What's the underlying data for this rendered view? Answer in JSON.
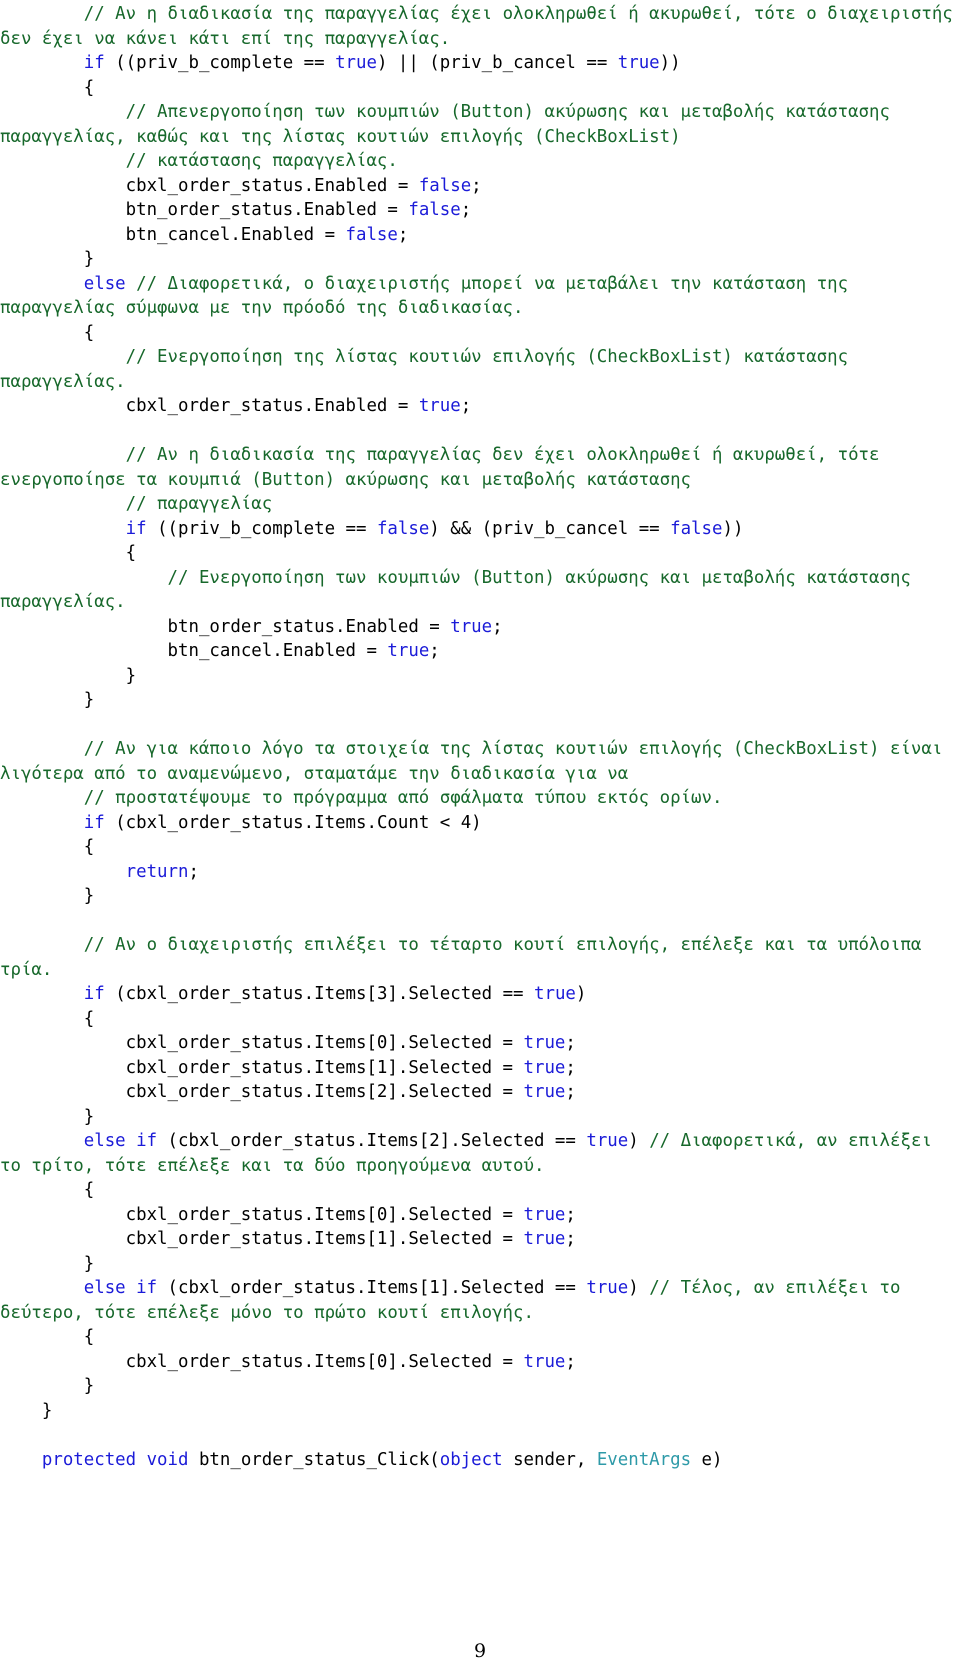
{
  "page": {
    "number": "9",
    "language": "csharp",
    "colors": {
      "comment": "#17682b",
      "keyword": "#1b1bd8",
      "type": "#2e9aa8",
      "plain": "#000000",
      "background": "#ffffff"
    }
  },
  "code": {
    "lines": [
      {
        "indent": 2,
        "spans": [
          {
            "t": "cm",
            "s": "// Αν η διαδικασία της παραγγελίας έχει ολοκληρωθεί ή ακυρωθεί, τότε ο διαχειριστής δεν έχει να κάνει κάτι επί της παραγγελίας."
          }
        ]
      },
      {
        "indent": 2,
        "spans": [
          {
            "t": "kw",
            "s": "if"
          },
          {
            "t": "pl",
            "s": " ((priv_b_complete == "
          },
          {
            "t": "kw",
            "s": "true"
          },
          {
            "t": "pl",
            "s": ") || (priv_b_cancel == "
          },
          {
            "t": "kw",
            "s": "true"
          },
          {
            "t": "pl",
            "s": "))"
          }
        ]
      },
      {
        "indent": 2,
        "spans": [
          {
            "t": "pl",
            "s": "{"
          }
        ]
      },
      {
        "indent": 3,
        "spans": [
          {
            "t": "cm",
            "s": "// Απενεργοποίηση των κουμπιών (Button) ακύρωσης και μεταβολής κατάστασης παραγγελίας, καθώς και της λίστας κουτιών επιλογής (CheckBoxList)"
          }
        ]
      },
      {
        "indent": 3,
        "spans": [
          {
            "t": "cm",
            "s": "// κατάστασης παραγγελίας."
          }
        ]
      },
      {
        "indent": 3,
        "spans": [
          {
            "t": "pl",
            "s": "cbxl_order_status.Enabled = "
          },
          {
            "t": "kw",
            "s": "false"
          },
          {
            "t": "pl",
            "s": ";"
          }
        ]
      },
      {
        "indent": 3,
        "spans": [
          {
            "t": "pl",
            "s": "btn_order_status.Enabled = "
          },
          {
            "t": "kw",
            "s": "false"
          },
          {
            "t": "pl",
            "s": ";"
          }
        ]
      },
      {
        "indent": 3,
        "spans": [
          {
            "t": "pl",
            "s": "btn_cancel.Enabled = "
          },
          {
            "t": "kw",
            "s": "false"
          },
          {
            "t": "pl",
            "s": ";"
          }
        ]
      },
      {
        "indent": 2,
        "spans": [
          {
            "t": "pl",
            "s": "}"
          }
        ]
      },
      {
        "indent": 2,
        "spans": [
          {
            "t": "kw",
            "s": "else"
          },
          {
            "t": "pl",
            "s": " "
          },
          {
            "t": "cm",
            "s": "// Διαφορετικά, ο διαχειριστής μπορεί να μεταβάλει την κατάσταση της παραγγελίας σύμφωνα με την πρόοδό της διαδικασίας."
          }
        ]
      },
      {
        "indent": 2,
        "spans": [
          {
            "t": "pl",
            "s": "{"
          }
        ]
      },
      {
        "indent": 3,
        "spans": [
          {
            "t": "cm",
            "s": "// Ενεργοποίηση της λίστας κουτιών επιλογής (CheckBoxList) κατάστασης παραγγελίας."
          }
        ]
      },
      {
        "indent": 3,
        "spans": [
          {
            "t": "pl",
            "s": "cbxl_order_status.Enabled = "
          },
          {
            "t": "kw",
            "s": "true"
          },
          {
            "t": "pl",
            "s": ";"
          }
        ]
      },
      {
        "blank": true
      },
      {
        "indent": 3,
        "spans": [
          {
            "t": "cm",
            "s": "// Αν η διαδικασία της παραγγελίας δεν έχει ολοκληρωθεί ή ακυρωθεί, τότε ενεργοποίησε τα κουμπιά (Button) ακύρωσης και μεταβολής κατάστασης"
          }
        ]
      },
      {
        "indent": 3,
        "spans": [
          {
            "t": "cm",
            "s": "// παραγγελίας"
          }
        ]
      },
      {
        "indent": 3,
        "spans": [
          {
            "t": "kw",
            "s": "if"
          },
          {
            "t": "pl",
            "s": " ((priv_b_complete == "
          },
          {
            "t": "kw",
            "s": "false"
          },
          {
            "t": "pl",
            "s": ") && (priv_b_cancel == "
          },
          {
            "t": "kw",
            "s": "false"
          },
          {
            "t": "pl",
            "s": "))"
          }
        ]
      },
      {
        "indent": 3,
        "spans": [
          {
            "t": "pl",
            "s": "{"
          }
        ]
      },
      {
        "indent": 4,
        "spans": [
          {
            "t": "cm",
            "s": "// Ενεργοποίηση των κουμπιών (Button) ακύρωσης και μεταβολής κατάστασης παραγγελίας."
          }
        ]
      },
      {
        "indent": 4,
        "spans": [
          {
            "t": "pl",
            "s": "btn_order_status.Enabled = "
          },
          {
            "t": "kw",
            "s": "true"
          },
          {
            "t": "pl",
            "s": ";"
          }
        ]
      },
      {
        "indent": 4,
        "spans": [
          {
            "t": "pl",
            "s": "btn_cancel.Enabled = "
          },
          {
            "t": "kw",
            "s": "true"
          },
          {
            "t": "pl",
            "s": ";"
          }
        ]
      },
      {
        "indent": 3,
        "spans": [
          {
            "t": "pl",
            "s": "}"
          }
        ]
      },
      {
        "indent": 2,
        "spans": [
          {
            "t": "pl",
            "s": "}"
          }
        ]
      },
      {
        "blank": true
      },
      {
        "indent": 2,
        "spans": [
          {
            "t": "cm",
            "s": "// Αν για κάποιο λόγο τα στοιχεία της λίστας κουτιών επιλογής (CheckBoxList) είναι λιγότερα από το αναμενώμενο, σταματάμε την διαδικασία για να"
          }
        ]
      },
      {
        "indent": 2,
        "spans": [
          {
            "t": "cm",
            "s": "// προστατέψουμε το πρόγραμμα από σφάλματα τύπου εκτός ορίων."
          }
        ]
      },
      {
        "indent": 2,
        "spans": [
          {
            "t": "kw",
            "s": "if"
          },
          {
            "t": "pl",
            "s": " (cbxl_order_status.Items.Count < 4)"
          }
        ]
      },
      {
        "indent": 2,
        "spans": [
          {
            "t": "pl",
            "s": "{"
          }
        ]
      },
      {
        "indent": 3,
        "spans": [
          {
            "t": "kw",
            "s": "return"
          },
          {
            "t": "pl",
            "s": ";"
          }
        ]
      },
      {
        "indent": 2,
        "spans": [
          {
            "t": "pl",
            "s": "}"
          }
        ]
      },
      {
        "blank": true
      },
      {
        "indent": 2,
        "spans": [
          {
            "t": "cm",
            "s": "// Αν ο διαχειριστής επιλέξει το τέταρτο κουτί επιλογής, επέλεξε και τα υπόλοιπα τρία."
          }
        ]
      },
      {
        "indent": 2,
        "spans": [
          {
            "t": "kw",
            "s": "if"
          },
          {
            "t": "pl",
            "s": " (cbxl_order_status.Items[3].Selected == "
          },
          {
            "t": "kw",
            "s": "true"
          },
          {
            "t": "pl",
            "s": ")"
          }
        ]
      },
      {
        "indent": 2,
        "spans": [
          {
            "t": "pl",
            "s": "{"
          }
        ]
      },
      {
        "indent": 3,
        "spans": [
          {
            "t": "pl",
            "s": "cbxl_order_status.Items[0].Selected = "
          },
          {
            "t": "kw",
            "s": "true"
          },
          {
            "t": "pl",
            "s": ";"
          }
        ]
      },
      {
        "indent": 3,
        "spans": [
          {
            "t": "pl",
            "s": "cbxl_order_status.Items[1].Selected = "
          },
          {
            "t": "kw",
            "s": "true"
          },
          {
            "t": "pl",
            "s": ";"
          }
        ]
      },
      {
        "indent": 3,
        "spans": [
          {
            "t": "pl",
            "s": "cbxl_order_status.Items[2].Selected = "
          },
          {
            "t": "kw",
            "s": "true"
          },
          {
            "t": "pl",
            "s": ";"
          }
        ]
      },
      {
        "indent": 2,
        "spans": [
          {
            "t": "pl",
            "s": "}"
          }
        ]
      },
      {
        "indent": 2,
        "spans": [
          {
            "t": "kw",
            "s": "else if"
          },
          {
            "t": "pl",
            "s": " (cbxl_order_status.Items[2].Selected == "
          },
          {
            "t": "kw",
            "s": "true"
          },
          {
            "t": "pl",
            "s": ") "
          },
          {
            "t": "cm",
            "s": "// Διαφορετικά, αν επιλέξει το τρίτο, τότε επέλεξε και τα δύο προηγούμενα αυτού."
          }
        ]
      },
      {
        "indent": 2,
        "spans": [
          {
            "t": "pl",
            "s": "{"
          }
        ]
      },
      {
        "indent": 3,
        "spans": [
          {
            "t": "pl",
            "s": "cbxl_order_status.Items[0].Selected = "
          },
          {
            "t": "kw",
            "s": "true"
          },
          {
            "t": "pl",
            "s": ";"
          }
        ]
      },
      {
        "indent": 3,
        "spans": [
          {
            "t": "pl",
            "s": "cbxl_order_status.Items[1].Selected = "
          },
          {
            "t": "kw",
            "s": "true"
          },
          {
            "t": "pl",
            "s": ";"
          }
        ]
      },
      {
        "indent": 2,
        "spans": [
          {
            "t": "pl",
            "s": "}"
          }
        ]
      },
      {
        "indent": 2,
        "spans": [
          {
            "t": "kw",
            "s": "else if"
          },
          {
            "t": "pl",
            "s": " (cbxl_order_status.Items[1].Selected == "
          },
          {
            "t": "kw",
            "s": "true"
          },
          {
            "t": "pl",
            "s": ") "
          },
          {
            "t": "cm",
            "s": "// Τέλος, αν επιλέξει το δεύτερο, τότε επέλεξε μόνο το πρώτο κουτί επιλογής."
          }
        ]
      },
      {
        "indent": 2,
        "spans": [
          {
            "t": "pl",
            "s": "{"
          }
        ]
      },
      {
        "indent": 3,
        "spans": [
          {
            "t": "pl",
            "s": "cbxl_order_status.Items[0].Selected = "
          },
          {
            "t": "kw",
            "s": "true"
          },
          {
            "t": "pl",
            "s": ";"
          }
        ]
      },
      {
        "indent": 2,
        "spans": [
          {
            "t": "pl",
            "s": "}"
          }
        ]
      },
      {
        "indent": 1,
        "spans": [
          {
            "t": "pl",
            "s": "}"
          }
        ]
      },
      {
        "blank": true
      },
      {
        "indent": 1,
        "spans": [
          {
            "t": "kw",
            "s": "protected void"
          },
          {
            "t": "pl",
            "s": " btn_order_status_Click("
          },
          {
            "t": "kw",
            "s": "object"
          },
          {
            "t": "pl",
            "s": " sender, "
          },
          {
            "t": "ty",
            "s": "EventArgs"
          },
          {
            "t": "pl",
            "s": " e)"
          }
        ]
      }
    ]
  }
}
